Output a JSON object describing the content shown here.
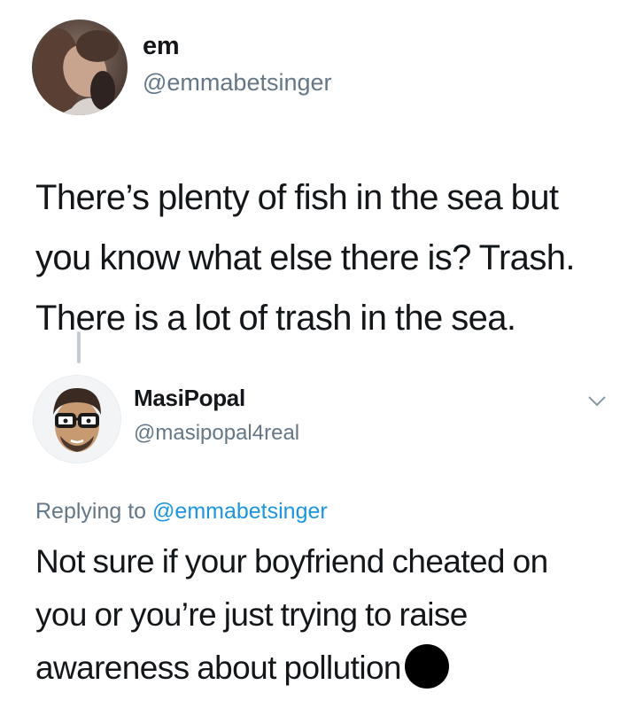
{
  "tweet": {
    "author": {
      "name": "em",
      "handle": "@emmabetsinger",
      "avatar_icon": "profile-photo"
    },
    "text": "There’s plenty of fish in the sea but you know what else there is? Trash. There is a lot of trash in the sea."
  },
  "reply": {
    "author": {
      "name": "MasiPopal",
      "handle": "@masipopal4real",
      "avatar_icon": "cartoon-avatar-glasses"
    },
    "replying_label": "Replying to",
    "replying_to": "@emmabetsinger",
    "text": "Not sure if your boyfriend cheated on you or you’re just trying to raise awareness about pollution",
    "redacted_emoji_icon": "black-circle"
  },
  "colors": {
    "text": "#14171a",
    "secondary_text": "#657786",
    "link": "#1b95e0",
    "thread_line": "#c4ccd3"
  }
}
